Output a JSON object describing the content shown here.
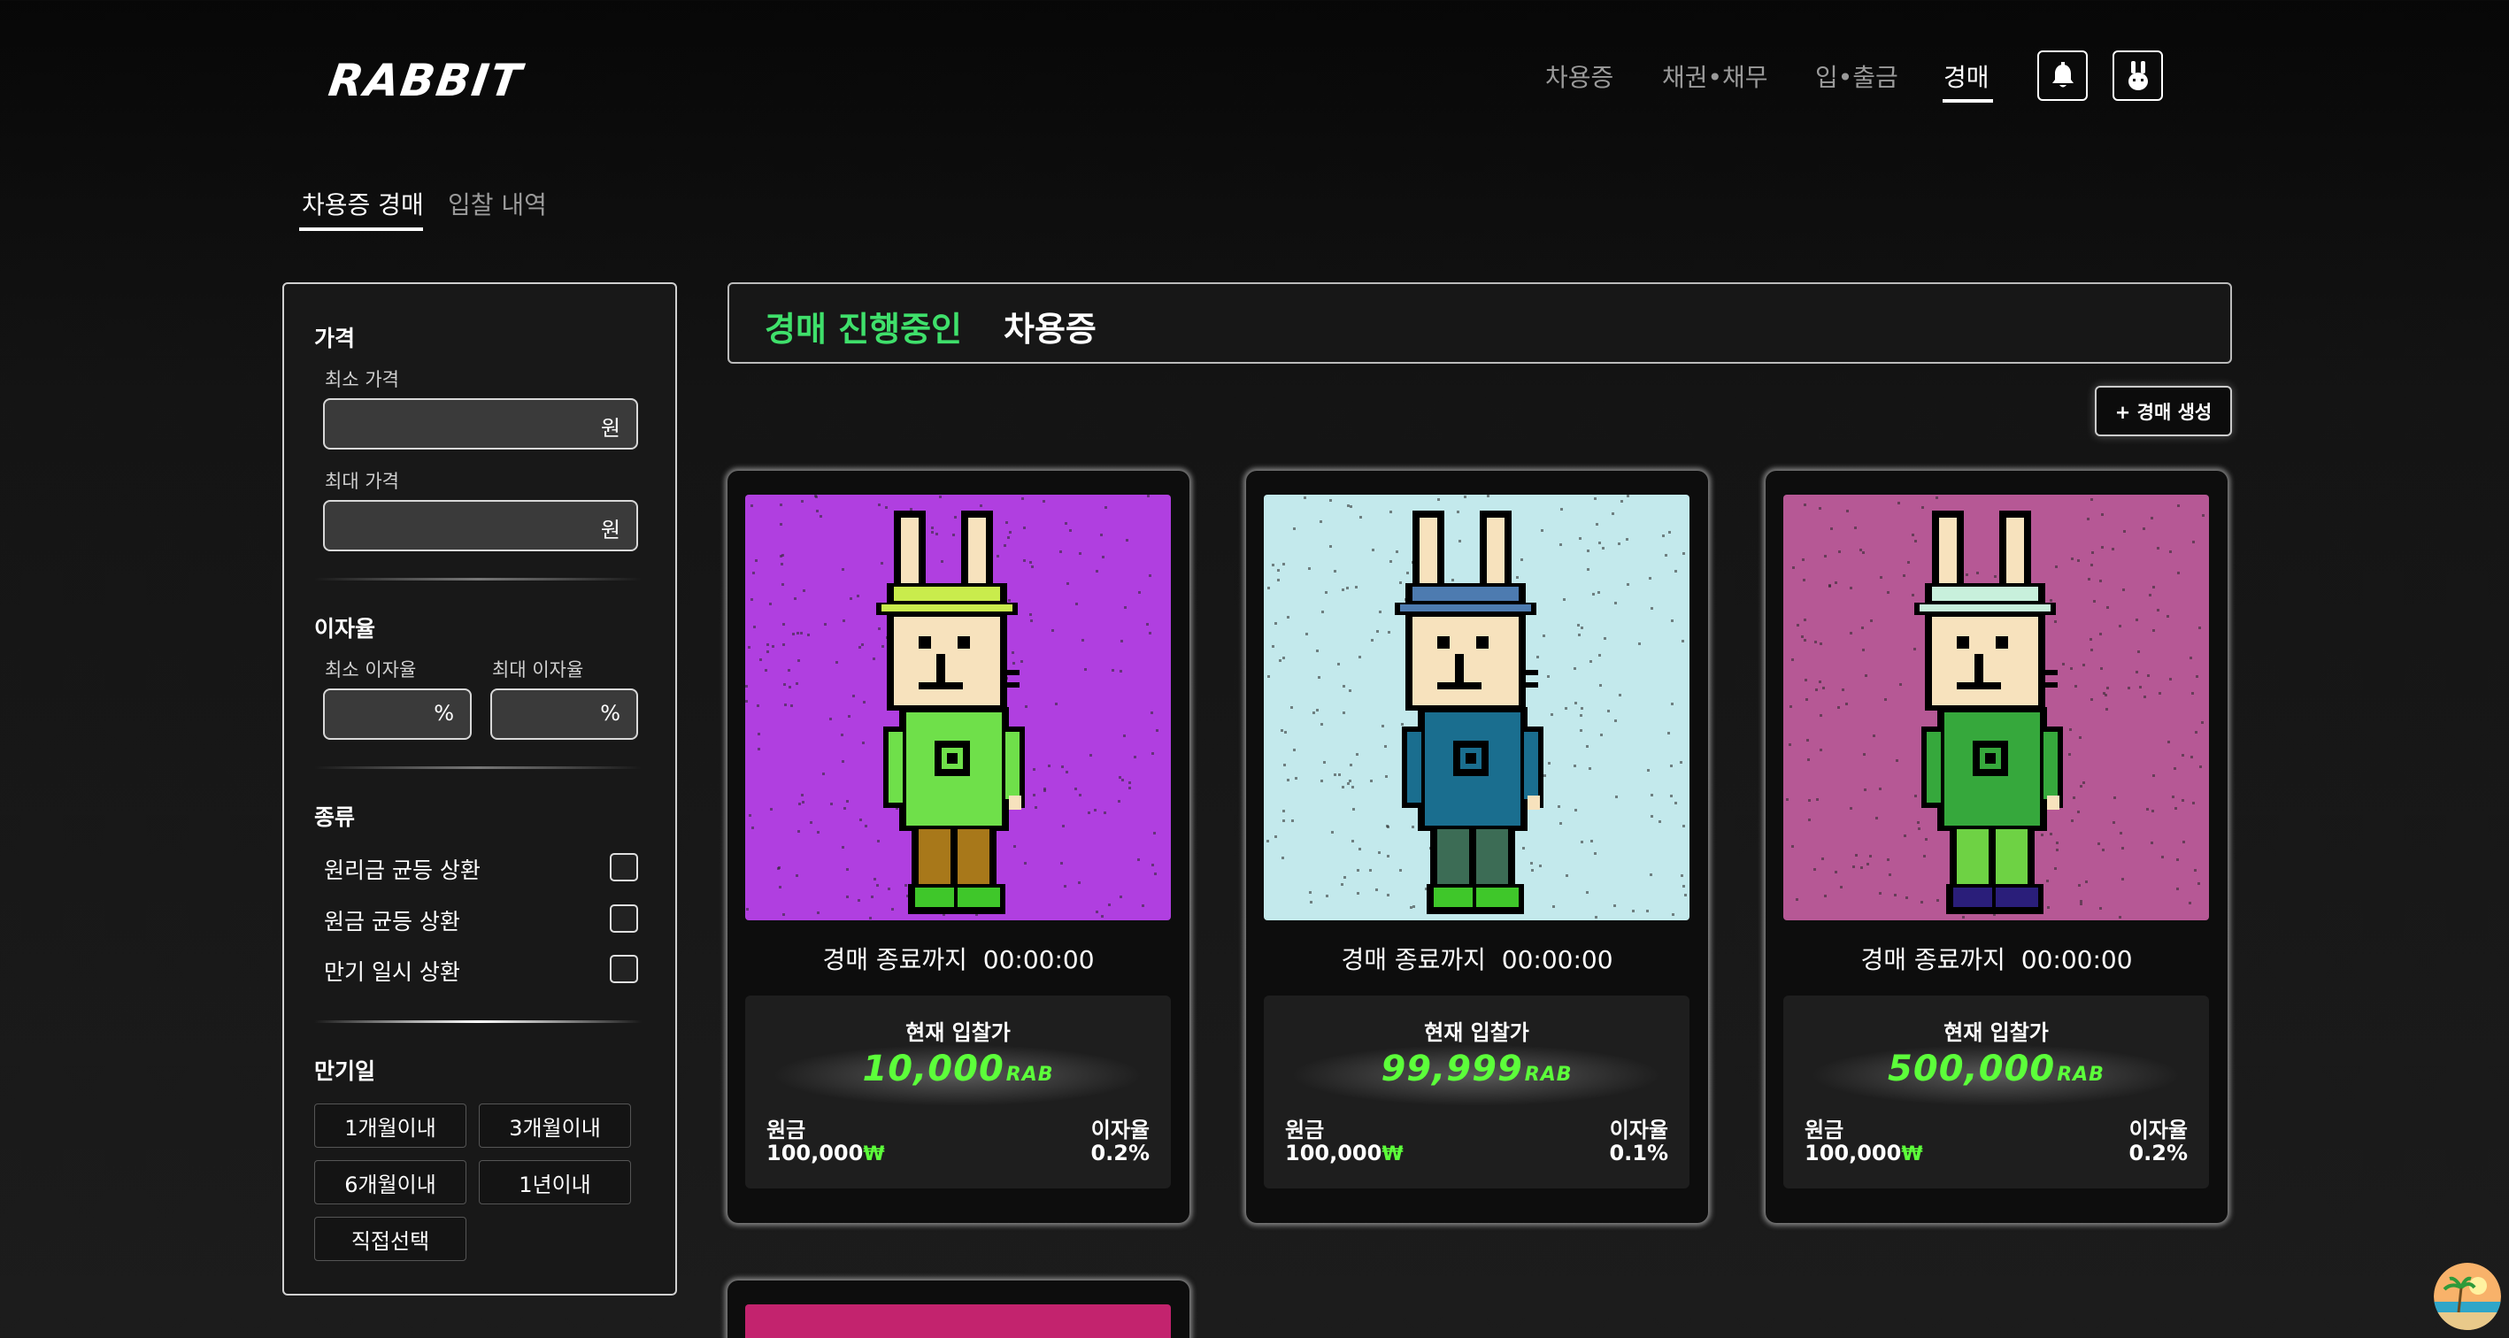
{
  "header": {
    "logo": "RABBIT",
    "nav": [
      "차용증",
      "채권•채무",
      "입•출금",
      "경매"
    ],
    "active_nav": "경매"
  },
  "subtabs": [
    "차용증 경매",
    "입찰 내역"
  ],
  "sidebar": {
    "price": {
      "heading": "가격",
      "min_label": "최소 가격",
      "max_label": "최대 가격",
      "unit": "원"
    },
    "rate": {
      "heading": "이자율",
      "min_label": "최소 이자율",
      "max_label": "최대 이자율",
      "unit": "%"
    },
    "type": {
      "heading": "종류",
      "options": [
        "원리금 균등 상환",
        "원금 균등 상환",
        "만기 일시 상환"
      ]
    },
    "maturity": {
      "heading": "만기일",
      "chips": [
        "1개월이내",
        "3개월이내",
        "6개월이내",
        "1년이내",
        "직접선택"
      ]
    }
  },
  "main": {
    "banner_green": "경매 진행중인",
    "banner_white": "차용증",
    "create_button": "+ 경매 생성",
    "cards": [
      {
        "timer_label": "경매 종료까지",
        "timer": "00:00:00",
        "bid_label": "현재 입찰가",
        "bid": "10,000",
        "bid_unit": "RAB",
        "principal_label": "원금",
        "principal": "100,000",
        "currency_symbol": "₩",
        "rate_label": "이자율",
        "rate": "0.2%",
        "bg_color": "#b03fe0",
        "hat_color": "#c9ec4c",
        "shirt_color": "#6fe04a",
        "pants_color": "#a8781a",
        "shoe_color": "#3fc72a"
      },
      {
        "timer_label": "경매 종료까지",
        "timer": "00:00:00",
        "bid_label": "현재 입찰가",
        "bid": "99,999",
        "bid_unit": "RAB",
        "principal_label": "원금",
        "principal": "100,000",
        "currency_symbol": "₩",
        "rate_label": "이자율",
        "rate": "0.1%",
        "bg_color": "#c3e9ec",
        "hat_color": "#4d7bb0",
        "shirt_color": "#1a6e8f",
        "pants_color": "#3c6c55",
        "shoe_color": "#3fc72a"
      },
      {
        "timer_label": "경매 종료까지",
        "timer": "00:00:00",
        "bid_label": "현재 입찰가",
        "bid": "500,000",
        "bid_unit": "RAB",
        "principal_label": "원금",
        "principal": "100,000",
        "currency_symbol": "₩",
        "rate_label": "이자율",
        "rate": "0.2%",
        "bg_color": "#b65895",
        "hat_color": "#c8f0dc",
        "shirt_color": "#36a83c",
        "pants_color": "#6ed244",
        "shoe_color": "#2a1e7a"
      }
    ]
  },
  "colors": {
    "accent_green": "#3fe06b",
    "bid_green": "#5cff3a"
  }
}
